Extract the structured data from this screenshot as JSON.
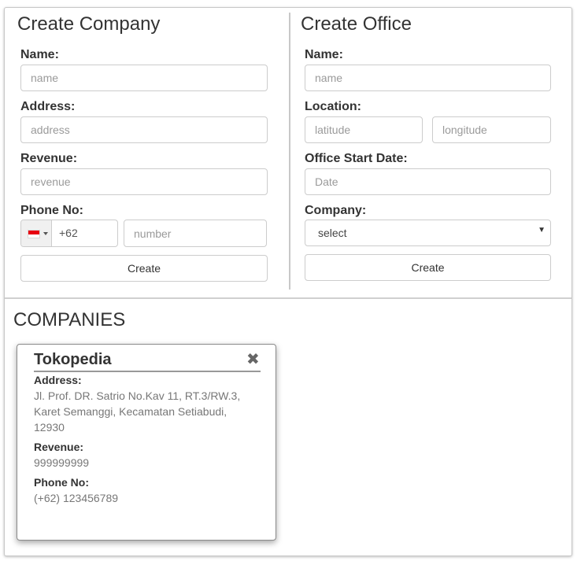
{
  "company_form": {
    "title": "Create Company",
    "name_label": "Name:",
    "name_placeholder": "name",
    "address_label": "Address:",
    "address_placeholder": "address",
    "revenue_label": "Revenue:",
    "revenue_placeholder": "revenue",
    "phone_label": "Phone No:",
    "phone_country_code": "+62",
    "phone_country_flag": "id-flag-icon",
    "phone_number_placeholder": "number",
    "create_label": "Create"
  },
  "office_form": {
    "title": "Create Office",
    "name_label": "Name:",
    "name_placeholder": "name",
    "location_label": "Location:",
    "latitude_placeholder": "latitude",
    "longitude_placeholder": "longitude",
    "start_date_label": "Office Start Date:",
    "start_date_placeholder": "Date",
    "company_label": "Company:",
    "company_selected": "select",
    "create_label": "Create"
  },
  "companies": {
    "title": "COMPANIES",
    "items": [
      {
        "name": "Tokopedia",
        "address_label": "Address:",
        "address_lines": [
          "Jl. Prof. DR. Satrio No.Kav 11, RT.3/RW.3,",
          "Karet Semanggi, Kecamatan Setiabudi,",
          "12930"
        ],
        "revenue_label": "Revenue:",
        "revenue": "999999999",
        "phone_label": "Phone No:",
        "phone": "(+62) 123456789",
        "close_icon": "close-icon"
      }
    ]
  },
  "colors": {
    "flag_red": "#e70011",
    "border": "#cccccc"
  }
}
